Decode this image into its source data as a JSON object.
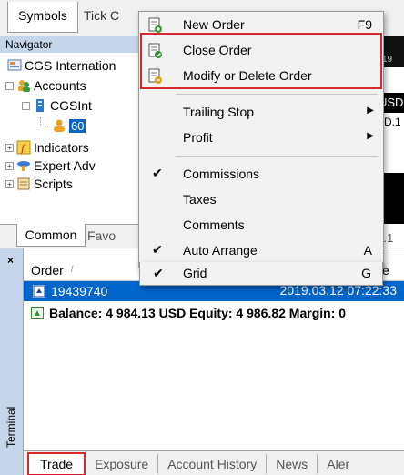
{
  "top_tabs": {
    "symbols": "Symbols",
    "tick": "Tick C"
  },
  "navigator": {
    "title": "Navigator",
    "tree": {
      "broker": "CGS Internation",
      "accounts": "Accounts",
      "server": "CGSInt",
      "account_number": "60",
      "indicators": "Indicators",
      "experts": "Expert Adv",
      "scripts": "Scripts"
    },
    "tabs": {
      "common": "Common",
      "favorites": "Favo"
    }
  },
  "chart_strip": {
    "date": "19",
    "symbol": "USD",
    "tf1": "SD.1",
    "tf2": "D.1"
  },
  "context_menu": {
    "new_order": {
      "label": "New Order",
      "shortcut": "F9"
    },
    "close_order": {
      "label": "Close Order"
    },
    "modify_order": {
      "label": "Modify or Delete Order"
    },
    "trailing_stop": {
      "label": "Trailing Stop"
    },
    "profit": {
      "label": "Profit"
    },
    "commissions": {
      "label": "Commissions",
      "checked": true
    },
    "taxes": {
      "label": "Taxes"
    },
    "comments": {
      "label": "Comments"
    },
    "auto_arrange": {
      "label": "Auto Arrange",
      "shortcut": "A",
      "checked": true
    },
    "grid": {
      "label": "Grid",
      "shortcut": "G",
      "checked": true
    }
  },
  "terminal": {
    "close": "×",
    "side_label": "Terminal",
    "columns": {
      "order": "Order",
      "sort": "/",
      "e": "e"
    },
    "order": {
      "id": "19439740",
      "time": "2019.03.12 07:22:33"
    },
    "balance_line": "Balance: 4 984.13 USD  Equity: 4 986.82  Margin: 0",
    "tabs": {
      "trade": "Trade",
      "exposure": "Exposure",
      "history": "Account History",
      "news": "News",
      "alerts": "Aler"
    }
  },
  "colors": {
    "selection": "#0066cc",
    "highlight": "#d42a2a",
    "panel_title": "#c6d6ea"
  }
}
